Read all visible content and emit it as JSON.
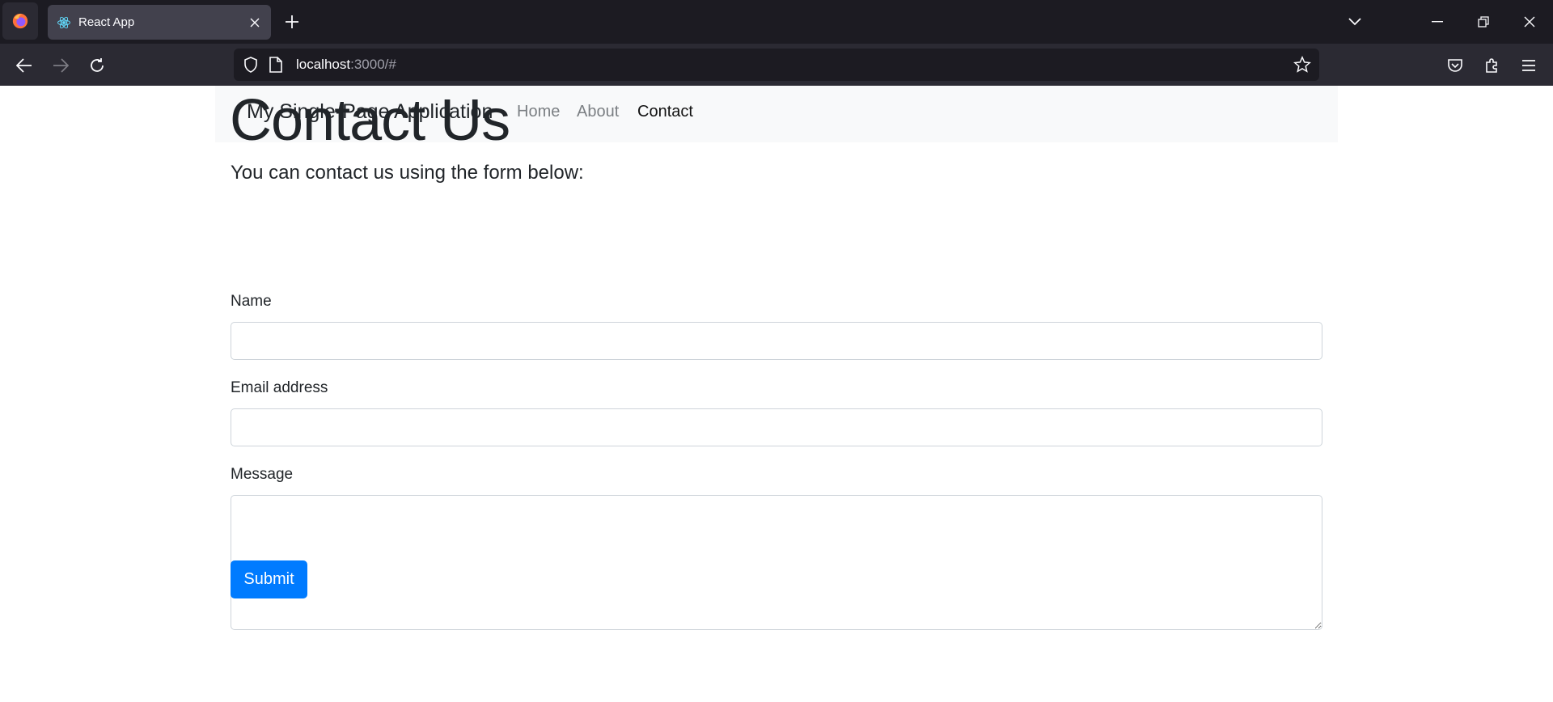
{
  "browser": {
    "tab": {
      "title": "React App"
    },
    "address": {
      "host": "localhost",
      "rest": ":3000/#"
    }
  },
  "site": {
    "brand": "My Single-Page Application",
    "nav": [
      {
        "label": "Home",
        "active": false
      },
      {
        "label": "About",
        "active": false
      },
      {
        "label": "Contact",
        "active": true
      }
    ]
  },
  "page": {
    "title": "Contact Us",
    "lead": "You can contact us using the form below:",
    "form": {
      "name_label": "Name",
      "name_value": "",
      "email_label": "Email address",
      "email_value": "",
      "message_label": "Message",
      "message_value": "",
      "submit_label": "Submit"
    }
  },
  "colors": {
    "primary": "#007bff",
    "nav_bg": "#f8f9fa",
    "chrome_dark": "#1c1b22",
    "chrome_mid": "#2b2a33"
  }
}
